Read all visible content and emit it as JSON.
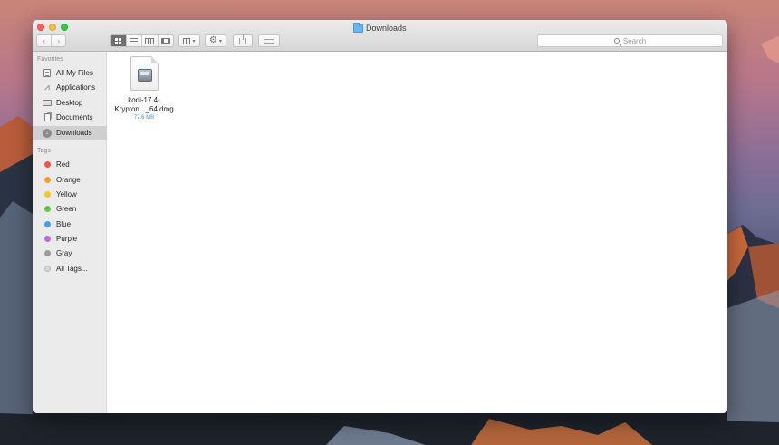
{
  "window": {
    "title": "Downloads"
  },
  "toolbar": {
    "back_icon": "chevron-left-icon",
    "forward_icon": "chevron-right-icon",
    "view_modes": [
      "icon-view",
      "list-view",
      "column-view",
      "cover-flow-view"
    ],
    "active_view": "icon-view",
    "arrange_icon": "arrange-icon",
    "action_icon": "gear-icon",
    "share_icon": "share-icon",
    "tag_icon": "tag-icon"
  },
  "search": {
    "placeholder": "Search"
  },
  "sidebar": {
    "favorites_header": "Favorites",
    "favorites": [
      {
        "label": "All My Files",
        "icon": "all-my-files-icon"
      },
      {
        "label": "Applications",
        "icon": "applications-icon"
      },
      {
        "label": "Desktop",
        "icon": "desktop-icon"
      },
      {
        "label": "Documents",
        "icon": "documents-icon"
      },
      {
        "label": "Downloads",
        "icon": "downloads-icon",
        "selected": true
      }
    ],
    "tags_header": "Tags",
    "tags": [
      {
        "label": "Red",
        "color": "#f2534d"
      },
      {
        "label": "Orange",
        "color": "#f79c2b"
      },
      {
        "label": "Yellow",
        "color": "#f5c81c"
      },
      {
        "label": "Green",
        "color": "#5bcb47"
      },
      {
        "label": "Blue",
        "color": "#3f9ff5"
      },
      {
        "label": "Purple",
        "color": "#bc6bd9"
      },
      {
        "label": "Gray",
        "color": "#9b9b9b"
      },
      {
        "label": "All Tags...",
        "color": "#d6d6d6"
      }
    ]
  },
  "files": [
    {
      "name_line1": "kodi-17.4-",
      "name_line2": "Krypton..._64.dmg",
      "size": "77.6 MB",
      "icon": "dmg-disk-image-icon"
    }
  ]
}
